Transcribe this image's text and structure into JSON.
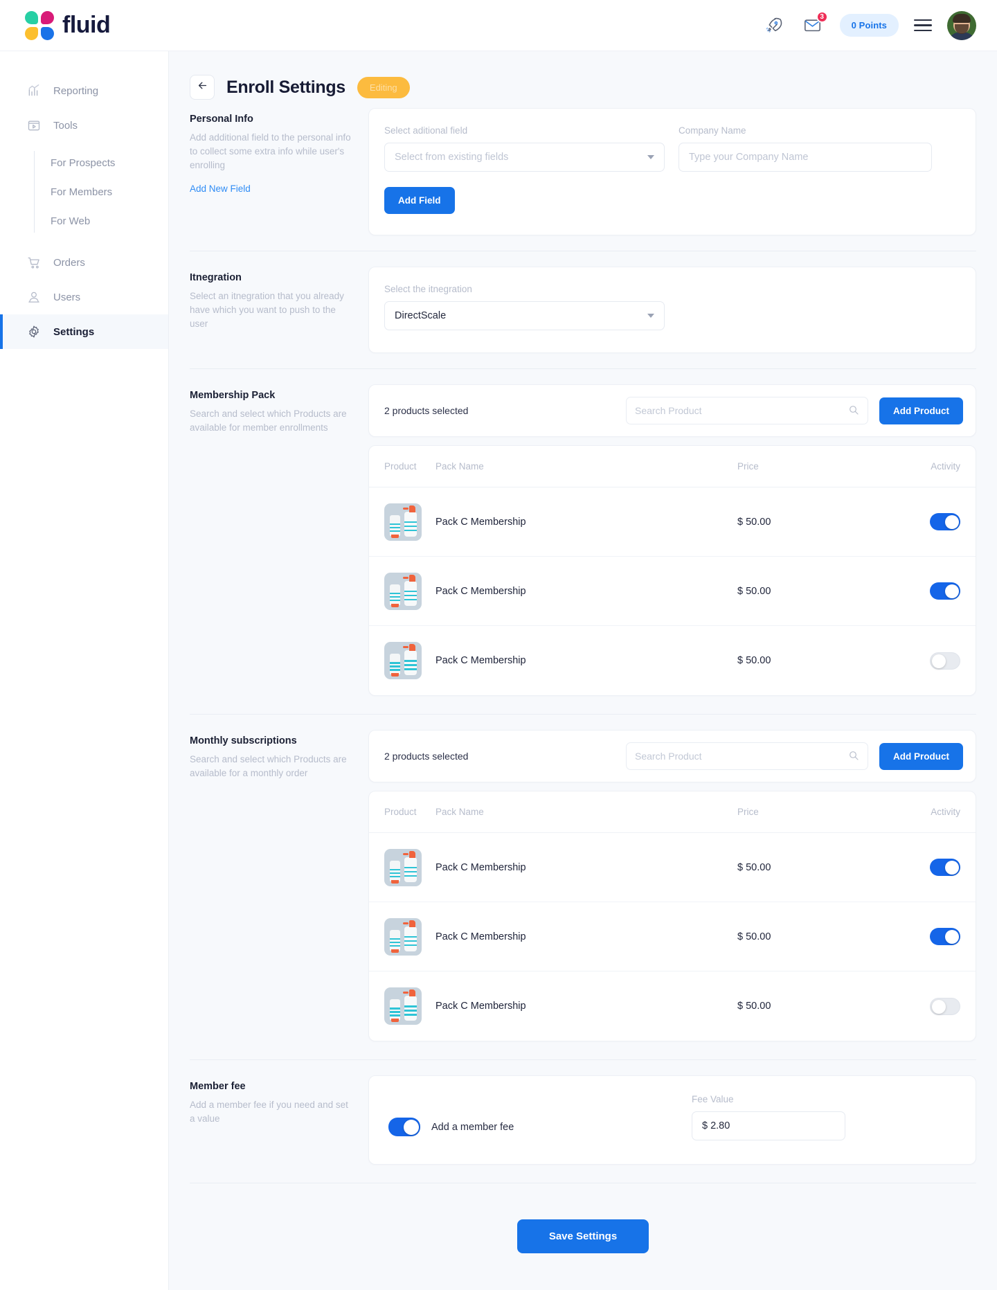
{
  "brand": {
    "name": "fluid",
    "logo_icon": "fluid-petals-logo"
  },
  "topbar": {
    "rocket_icon": "rocket-icon",
    "mail_icon": "envelope-icon",
    "mail_badge": "3",
    "points_label": "0 Points",
    "menu_icon": "hamburger-menu-icon",
    "avatar_icon": "user-avatar"
  },
  "sidebar": {
    "items": [
      {
        "label": "Reporting",
        "icon": "bar-chart-icon"
      },
      {
        "label": "Tools",
        "icon": "video-player-icon"
      },
      {
        "label": "Orders",
        "icon": "shopping-cart-icon"
      },
      {
        "label": "Users",
        "icon": "user-icon"
      },
      {
        "label": "Settings",
        "icon": "gear-icon"
      }
    ],
    "subitems": [
      {
        "label": "For Prospects"
      },
      {
        "label": "For Members"
      },
      {
        "label": "For Web"
      }
    ]
  },
  "page": {
    "back_icon": "arrow-left-icon",
    "title": "Enroll Settings",
    "status_badge": "Editing"
  },
  "personal_info": {
    "title": "Personal Info",
    "description": "Add additional field to the personal info to collect some extra info while user's enrolling",
    "add_new_field_link": "Add New Field",
    "select_label": "Select aditional field",
    "select_placeholder": "Select from existing fields",
    "company_label": "Company Name",
    "company_placeholder": "Type your Company Name",
    "add_field_button": "Add Field"
  },
  "integration": {
    "title": "Itnegration",
    "description": "Select an itnegration that you already have which you want to push to the user",
    "select_label": "Select the itnegration",
    "select_value": "DirectScale"
  },
  "membership_pack": {
    "title": "Membership Pack",
    "description": "Search and select which Products are available for member enrollments",
    "selected_count": "2 products selected",
    "search_placeholder": "Search Product",
    "search_icon": "search-icon",
    "add_product_button": "Add Product",
    "columns": [
      "Product",
      "Pack Name",
      "Price",
      "Activity"
    ],
    "rows": [
      {
        "thumb": "product-bottle-thumbnail",
        "name": "Pack C Membership",
        "price": "$ 50.00",
        "active": true
      },
      {
        "thumb": "product-bottle-thumbnail",
        "name": "Pack C Membership",
        "price": "$ 50.00",
        "active": true
      },
      {
        "thumb": "product-bottle-thumbnail",
        "name": "Pack C Membership",
        "price": "$ 50.00",
        "active": false
      }
    ]
  },
  "monthly_subscriptions": {
    "title": "Monthly subscriptions",
    "description": "Search and select which Products are available for a monthly order",
    "selected_count": "2 products selected",
    "search_placeholder": "Search Product",
    "search_icon": "search-icon",
    "add_product_button": "Add Product",
    "columns": [
      "Product",
      "Pack Name",
      "Price",
      "Activity"
    ],
    "rows": [
      {
        "thumb": "product-bottle-thumbnail",
        "name": "Pack C Membership",
        "price": "$ 50.00",
        "active": true
      },
      {
        "thumb": "product-bottle-thumbnail",
        "name": "Pack C Membership",
        "price": "$ 50.00",
        "active": true
      },
      {
        "thumb": "product-bottle-thumbnail",
        "name": "Pack C Membership",
        "price": "$ 50.00",
        "active": false
      }
    ]
  },
  "member_fee": {
    "title": "Member fee",
    "description": "Add a member fee if you need and set a value",
    "toggle_label": "Add a member fee",
    "toggle_active": true,
    "fee_label": "Fee Value",
    "fee_value": "$ 2.80"
  },
  "footer": {
    "save_button": "Save Settings"
  },
  "colors": {
    "accent": "#1773e8",
    "badge_amber": "#fcbb3f",
    "notification_red": "#ef2d56",
    "toggle_on": "#1565e8",
    "page_bg": "#f7f9fc"
  }
}
